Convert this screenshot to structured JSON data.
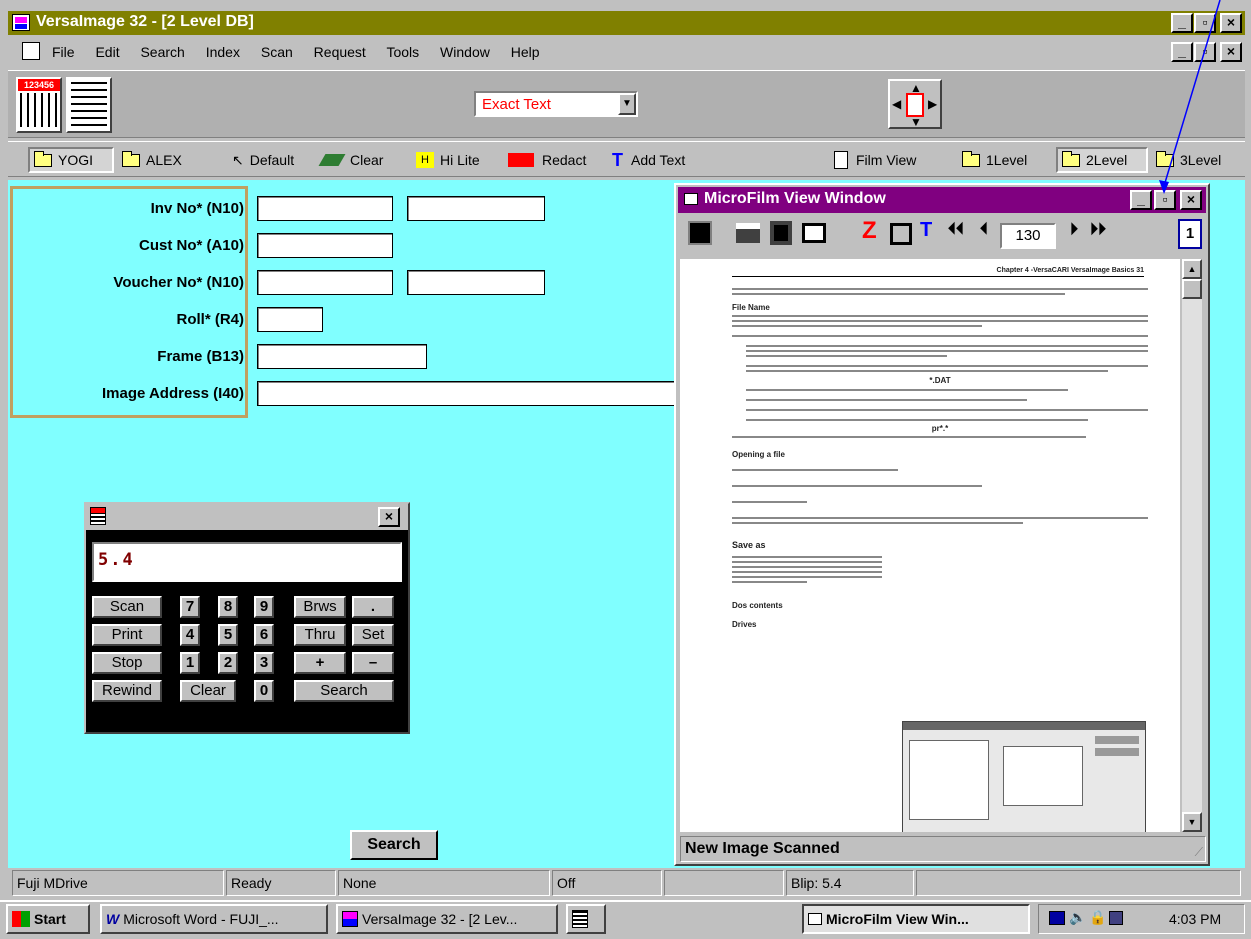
{
  "app": {
    "title": "VersaImage 32 - [2 Level DB]"
  },
  "menu": [
    "File",
    "Edit",
    "Search",
    "Index",
    "Scan",
    "Request",
    "Tools",
    "Window",
    "Help"
  ],
  "toolbar1": {
    "icon_label": "123456",
    "search_mode": "Exact Text"
  },
  "toolbar2": {
    "yogi": "YOGI",
    "alex": "ALEX",
    "default": "Default",
    "clear": "Clear",
    "hilite": "Hi Lite",
    "hilite_glyph": "H",
    "redact": "Redact",
    "addtext": "Add Text",
    "addtext_glyph": "T",
    "filmview": "Film View",
    "level1": "1Level",
    "level2": "2Level",
    "level3": "3Level"
  },
  "form": {
    "fields": [
      "Inv No* (N10)",
      "Cust No* (A10)",
      "Voucher No* (N10)",
      "Roll* (R4)",
      "Frame (B13)",
      "Image Address (I40)"
    ],
    "search_button": "Search"
  },
  "calc": {
    "display": "5.4",
    "buttons": {
      "scan": "Scan",
      "print": "Print",
      "stop": "Stop",
      "rewind": "Rewind",
      "clear": "Clear",
      "brws": "Brws",
      "thru": "Thru",
      "set": "Set",
      "plus": "+",
      "minus": "–",
      "dot": ".",
      "search": "Search"
    },
    "digits": [
      "7",
      "8",
      "9",
      "4",
      "5",
      "6",
      "1",
      "2",
      "3",
      "0"
    ]
  },
  "microfilm": {
    "title": "MicroFilm View Window",
    "frame_number": "130",
    "frame_badge": "1",
    "status": "New Image Scanned",
    "doc": {
      "header": "Chapter 4 -VersaCARI VersaImage Basics   31",
      "h_file_name": "File Name",
      "h_opening": "Opening a file",
      "h_save_as": "Save as",
      "h_dos": "Dos contents",
      "h_drives": "Drives",
      "star_dat": "*.DAT",
      "pr_star": "pr*.*"
    }
  },
  "statusbar": [
    "Fuji MDrive",
    "Ready",
    "None",
    "Off",
    "",
    "Blip: 5.4"
  ],
  "taskbar": {
    "start": "Start",
    "tasks": [
      "Microsoft Word - FUJI_...",
      "VersaImage 32 - [2 Lev...",
      "",
      "MicroFilm View Win..."
    ],
    "time": "4:03 PM"
  },
  "colors": {
    "titlebar": "#808000",
    "form_bg": "#80ffff",
    "form_border": "#c0a060",
    "microfilm_title": "#800080",
    "calc_bg": "#000000",
    "calc_display_text": "#800000"
  }
}
